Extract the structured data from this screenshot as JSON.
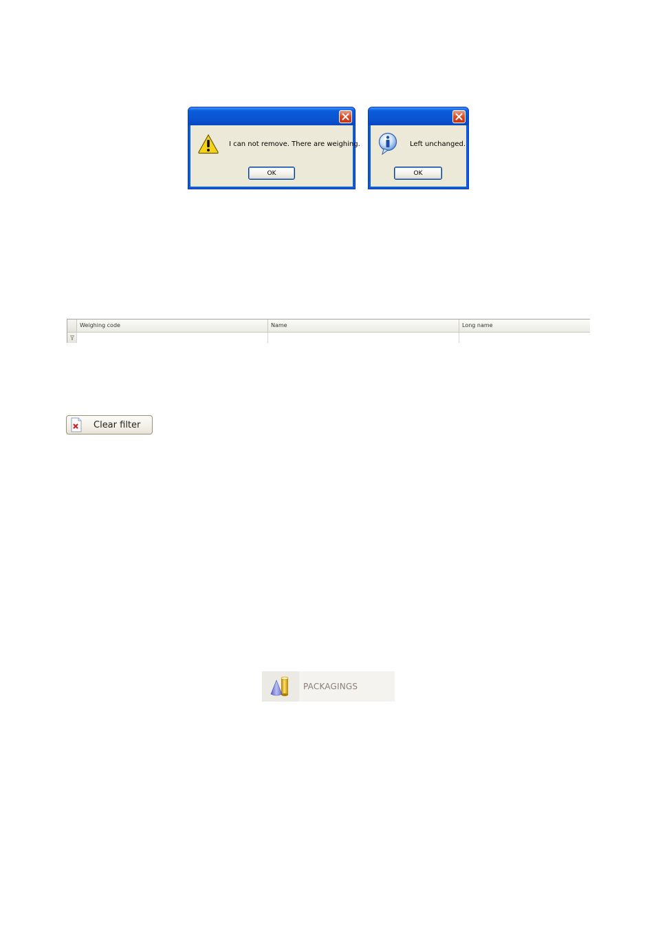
{
  "dialogs": [
    {
      "title": "",
      "message": "I can not remove. There are weighing.",
      "icon": "warning-icon",
      "ok_label": "OK"
    },
    {
      "title": "",
      "message": "Left unchanged.",
      "icon": "information-icon",
      "ok_label": "OK"
    }
  ],
  "grid": {
    "columns": [
      "Weighing code",
      "Name",
      "Long name"
    ],
    "filter_row_icon": "filter-icon"
  },
  "clear_filter": {
    "label": "Clear filter",
    "icon": "clear-filter-icon"
  },
  "packagings": {
    "label": "PACKAGINGS",
    "icon": "packagings-icon"
  },
  "colors": {
    "xp_title_blue": "#0a5ddb",
    "dialog_face": "#ece9d8",
    "close_red": "#d8461f",
    "warning_yellow": "#f5d21a",
    "info_blue": "#2f74d8"
  }
}
